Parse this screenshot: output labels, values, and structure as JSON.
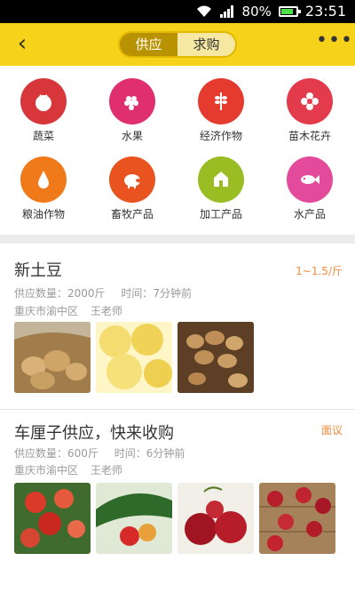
{
  "status_bar": {
    "battery": "80%",
    "time": "23:51"
  },
  "nav": {
    "back_icon": "chevron-left-icon",
    "tabs": [
      {
        "label": "供应"
      },
      {
        "label": "求购"
      }
    ],
    "more_icon": "more-icon",
    "colors": {
      "bar": "#f7d21b",
      "active_tab": "#b89200",
      "inactive_tab": "#f6e7a2"
    }
  },
  "categories": [
    {
      "label": "蔬菜",
      "icon": "tomato-icon",
      "color": "#d7373b"
    },
    {
      "label": "水果",
      "icon": "grapes-icon",
      "color": "#e02f6e"
    },
    {
      "label": "经济作物",
      "icon": "wheat-icon",
      "color": "#e53b2f"
    },
    {
      "label": "苗木花卉",
      "icon": "flower-icon",
      "color": "#e33b4b"
    },
    {
      "label": "粮油作物",
      "icon": "oil-drop-icon",
      "color": "#f07a1a"
    },
    {
      "label": "畜牧产品",
      "icon": "pig-icon",
      "color": "#e8531f"
    },
    {
      "label": "加工产品",
      "icon": "processing-icon",
      "color": "#9bbd24"
    },
    {
      "label": "水产品",
      "icon": "fish-icon",
      "color": "#e44a9b"
    }
  ],
  "listings": [
    {
      "title": "新土豆",
      "price": "1~1.5/斤",
      "quantity": "供应数量：2000斤",
      "time": "时间：7分钟前",
      "location": "重庆市渝中区",
      "seller": "王老师",
      "images": [
        "potatoes-sack-image",
        "sliced-potatoes-image",
        "potatoes-basket-image"
      ]
    },
    {
      "title": "车厘子供应，快来收购",
      "price": "面议",
      "quantity": "供应数量：600斤",
      "time": "时间：6分钟前",
      "location": "重庆市渝中区",
      "seller": "王老师",
      "images": [
        "cherries-tree-image",
        "cherries-leaves-image",
        "cherries-closeup-image",
        "cherries-wood-image"
      ]
    }
  ]
}
